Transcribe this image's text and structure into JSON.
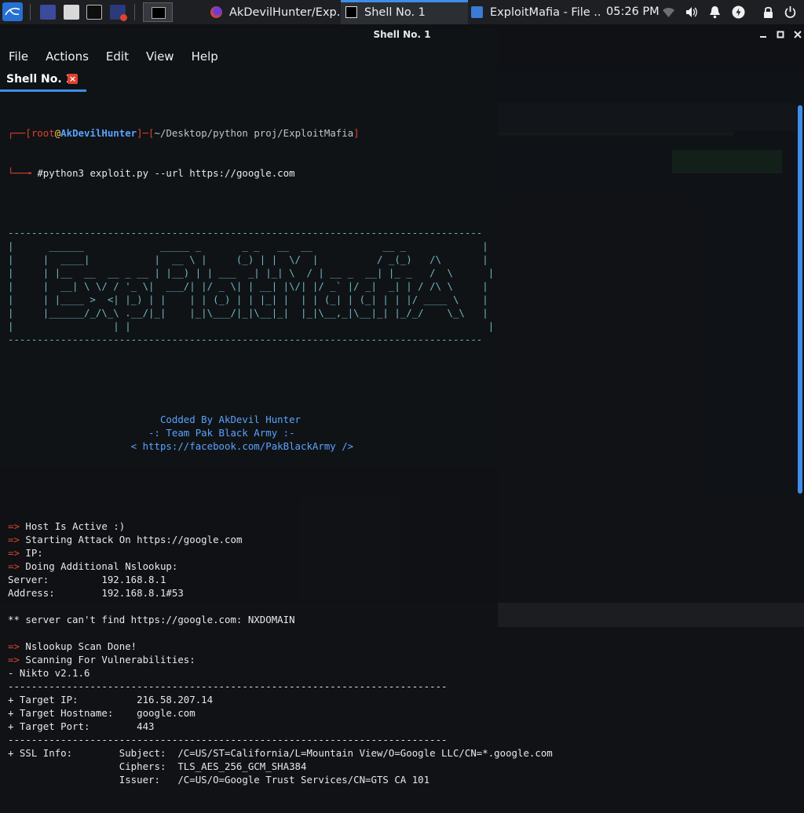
{
  "taskbar": {
    "tasks": [
      {
        "label": "AkDevilHunter/Exp...",
        "icon": "firefox-icon"
      },
      {
        "label": "Shell No. 1",
        "icon": "terminal-icon",
        "active": true
      },
      {
        "label": "ExploitMafia - File ...",
        "icon": "folder-icon"
      }
    ],
    "clock": "05:26 PM"
  },
  "window": {
    "title": "Shell No. 1",
    "menu": [
      "File",
      "Actions",
      "Edit",
      "View",
      "Help"
    ],
    "tab": {
      "label": "Shell No. 1",
      "close": "×"
    }
  },
  "colors": {
    "accent": "#3e8ee8",
    "prompt_red": "#e0422e",
    "prompt_blue": "#5aa2ff",
    "banner": "#6fb8c6"
  },
  "terminal": {
    "prompt": {
      "open": "┌──[",
      "user": "root",
      "at": "@",
      "host": "AkDevilHunter",
      "mid": "]─[",
      "path": "~/Desktop/python proj/ExploitMafia",
      "close": "]",
      "arrow": "└──╼ ",
      "command": "#python3 exploit.py --url https://google.com"
    },
    "banner": [
      "---------------------------------------------------------------------------------",
      "|      ______             _____ _       _ _   __  __            __ _             |",
      "|     |  ____|           |  __ \\ |     (_) | |  \\/  |          / _(_)   /\\       |",
      "|     | |__  __  __ _ __ | |__) | | ___  _| |_| \\  / | __ _  __| |_ _   /  \\      |",
      "|     |  __| \\ \\/ / '_ \\|  ___/| |/ _ \\| | __| |\\/| |/ _` |/ _|  _| | / /\\ \\     |",
      "|     | |____ >  <| |_) | |    | | (_) | | |_| |  | | (_| | (_| | | |/ ____ \\    |",
      "|     |______/_/\\_\\ .__/|_|    |_|\\___/|_|\\__|_|  |_|\\__,_|\\__|_| |_/_/    \\_\\   |",
      "|                 | |                                                             |",
      "---------------------------------------------------------------------------------"
    ],
    "credits": [
      "                          Codded By AkDevil Hunter",
      "                        -: Team Pak Black Army :-",
      "                     < https://facebook.com/PakBlackArmy />"
    ],
    "lines": [
      {
        "arrow": "=> ",
        "text": "Host Is Active :)"
      },
      {
        "arrow": "=> ",
        "text": "Starting Attack On https://google.com"
      },
      {
        "arrow": "=> ",
        "text": "IP:"
      },
      {
        "arrow": "=> ",
        "text": "Doing Additional Nslookup:"
      },
      {
        "arrow": "",
        "text": "Server:         192.168.8.1"
      },
      {
        "arrow": "",
        "text": "Address:        192.168.8.1#53"
      },
      {
        "arrow": "",
        "text": ""
      },
      {
        "arrow": "",
        "text": "** server can't find https://google.com: NXDOMAIN"
      },
      {
        "arrow": "",
        "text": ""
      },
      {
        "arrow": "=> ",
        "text": "Nslookup Scan Done!"
      },
      {
        "arrow": "=> ",
        "text": "Scanning For Vulnerabilities:"
      },
      {
        "arrow": "",
        "text": "- Nikto v2.1.6"
      },
      {
        "arrow": "",
        "text": "---------------------------------------------------------------------------"
      },
      {
        "arrow": "",
        "text": "+ Target IP:          216.58.207.14"
      },
      {
        "arrow": "",
        "text": "+ Target Hostname:    google.com"
      },
      {
        "arrow": "",
        "text": "+ Target Port:        443"
      },
      {
        "arrow": "",
        "text": "---------------------------------------------------------------------------"
      },
      {
        "arrow": "",
        "text": "+ SSL Info:        Subject:  /C=US/ST=California/L=Mountain View/O=Google LLC/CN=*.google.com"
      },
      {
        "arrow": "",
        "text": "                   Ciphers:  TLS_AES_256_GCM_SHA384"
      },
      {
        "arrow": "",
        "text": "                   Issuer:   /C=US/O=Google Trust Services/CN=GTS CA 101"
      }
    ]
  }
}
